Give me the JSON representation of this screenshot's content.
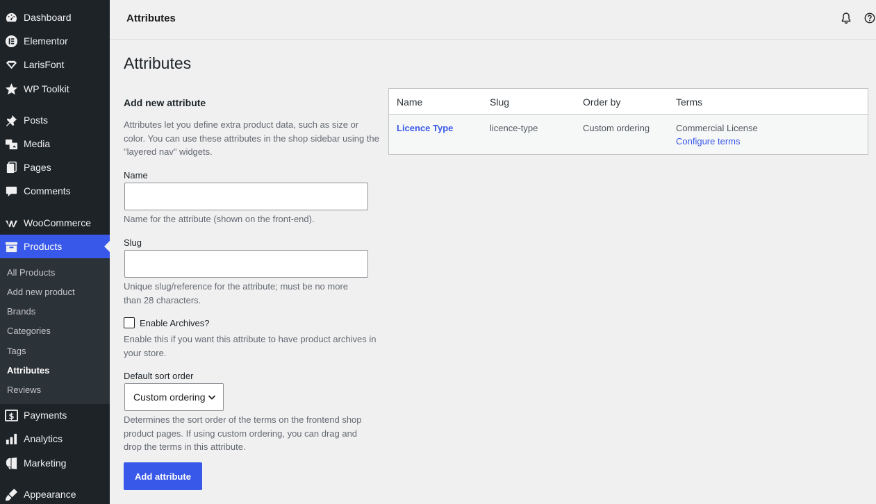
{
  "sidebar": {
    "items": [
      {
        "label": "Dashboard",
        "icon": "dashboard-icon"
      },
      {
        "label": "Elementor",
        "icon": "elementor-icon"
      },
      {
        "label": "LarisFont",
        "icon": "diamond-icon"
      },
      {
        "label": "WP Toolkit",
        "icon": "star-icon"
      },
      {
        "label": "Posts",
        "icon": "pin-icon"
      },
      {
        "label": "Media",
        "icon": "media-icon"
      },
      {
        "label": "Pages",
        "icon": "pages-icon"
      },
      {
        "label": "Comments",
        "icon": "comment-icon"
      },
      {
        "label": "WooCommerce",
        "icon": "woocommerce-icon"
      },
      {
        "label": "Products",
        "icon": "archive-icon"
      },
      {
        "label": "Payments",
        "icon": "dollar-icon"
      },
      {
        "label": "Analytics",
        "icon": "bar-chart-icon"
      },
      {
        "label": "Marketing",
        "icon": "megaphone-icon"
      },
      {
        "label": "Appearance",
        "icon": "brush-icon"
      }
    ],
    "submenu": [
      "All Products",
      "Add new product",
      "Brands",
      "Categories",
      "Tags",
      "Attributes",
      "Reviews"
    ],
    "active_item": "Products",
    "current_sub": "Attributes",
    "accent_color": "#3858e9"
  },
  "topbar": {
    "title": "Attributes",
    "bell_icon": "bell-icon",
    "help_icon": "help-icon"
  },
  "page_title": "Attributes",
  "form": {
    "heading": "Add new attribute",
    "intro": "Attributes let you define extra product data, such as size or color. You can use these attributes in the shop sidebar using the \"layered nav\" widgets.",
    "name_label": "Name",
    "name_value": "",
    "name_help": "Name for the attribute (shown on the front-end).",
    "slug_label": "Slug",
    "slug_value": "",
    "slug_help": "Unique slug/reference for the attribute; must be no more than 28 characters.",
    "archives_label": "Enable Archives?",
    "archives_checked": false,
    "archives_help": "Enable this if you want this attribute to have product archives in your store.",
    "sort_label": "Default sort order",
    "sort_value": "Custom ordering",
    "sort_help": "Determines the sort order of the terms on the frontend shop product pages. If using custom ordering, you can drag and drop the terms in this attribute.",
    "submit_label": "Add attribute"
  },
  "table": {
    "columns": [
      "Name",
      "Slug",
      "Order by",
      "Terms"
    ],
    "rows": [
      {
        "name": "Licence Type",
        "slug": "licence-type",
        "order_by": "Custom ordering",
        "terms": "Commercial License",
        "configure": "Configure terms"
      }
    ]
  }
}
